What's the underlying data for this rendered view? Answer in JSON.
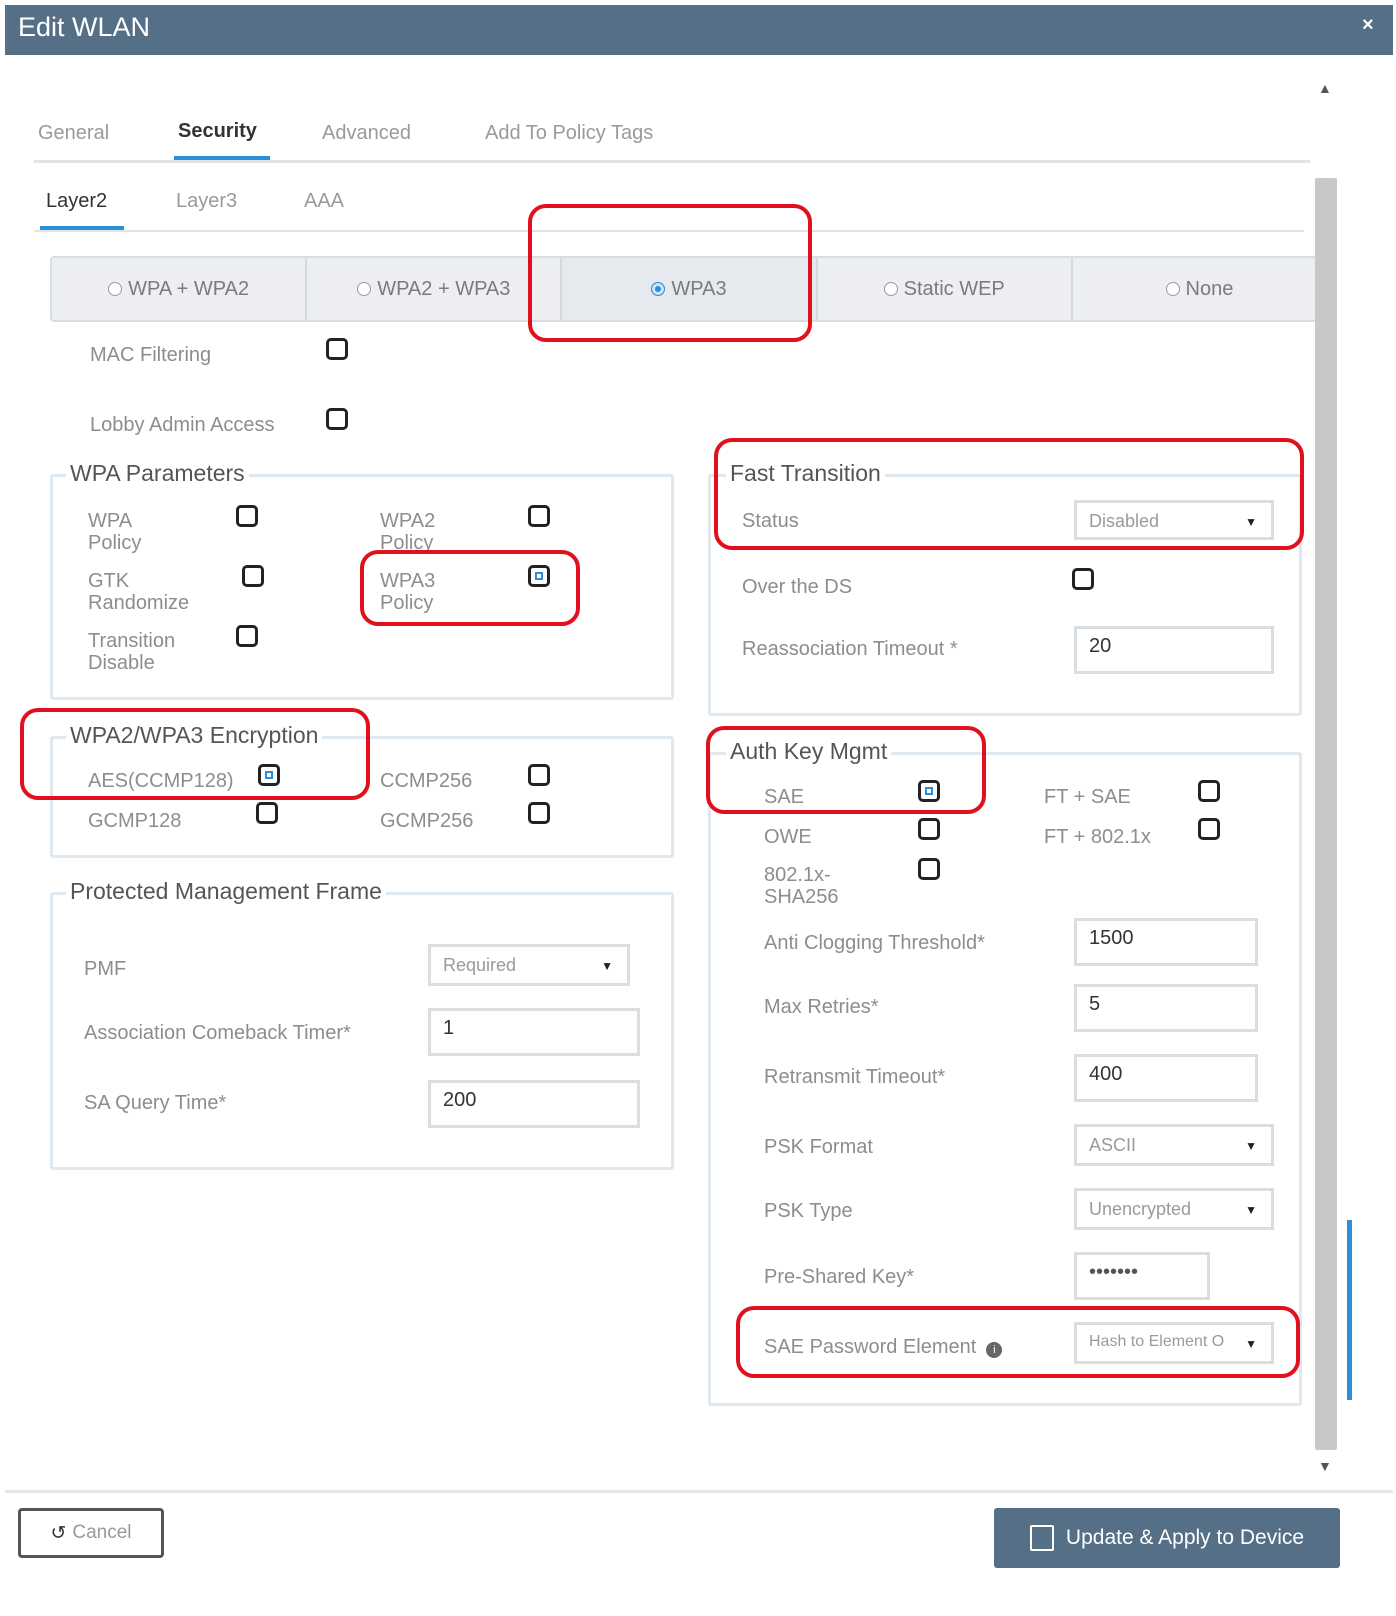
{
  "window": {
    "title": "Edit WLAN",
    "close_icon": "×"
  },
  "tabs": [
    {
      "label": "General"
    },
    {
      "label": "Security",
      "active": true
    },
    {
      "label": "Advanced"
    },
    {
      "label": "Add To Policy Tags"
    }
  ],
  "subtabs": [
    {
      "label": "Layer2",
      "active": true
    },
    {
      "label": "Layer3"
    },
    {
      "label": "AAA"
    }
  ],
  "security_modes": [
    {
      "label": "WPA + WPA2",
      "selected": false
    },
    {
      "label": "WPA2 + WPA3",
      "selected": false
    },
    {
      "label": "WPA3",
      "selected": true
    },
    {
      "label": "Static WEP",
      "selected": false
    },
    {
      "label": "None",
      "selected": false
    }
  ],
  "mac_filtering": {
    "label": "MAC Filtering",
    "checked": false
  },
  "lobby_admin": {
    "label": "Lobby Admin Access",
    "checked": false
  },
  "wpa_params": {
    "legend": "WPA Parameters",
    "wpa_policy": {
      "label": "WPA\nPolicy",
      "checked": false
    },
    "wpa2_policy": {
      "label": "WPA2\nPolicy",
      "checked": false
    },
    "gtk_randomize": {
      "label": "GTK\nRandomize",
      "checked": false
    },
    "wpa3_policy": {
      "label": "WPA3\nPolicy",
      "checked": true
    },
    "transition_disable": {
      "label": "Transition\nDisable",
      "checked": false
    }
  },
  "encryption": {
    "legend": "WPA2/WPA3 Encryption",
    "aes_ccmp128": {
      "label": "AES(CCMP128)",
      "checked": true
    },
    "ccmp256": {
      "label": "CCMP256",
      "checked": false
    },
    "gcmp128": {
      "label": "GCMP128",
      "checked": false
    },
    "gcmp256": {
      "label": "GCMP256",
      "checked": false
    }
  },
  "pmf": {
    "legend": "Protected Management Frame",
    "pmf_label": "PMF",
    "pmf_value": "Required",
    "comeback_label": "Association Comeback Timer*",
    "comeback_value": "1",
    "sa_query_label": "SA Query Time*",
    "sa_query_value": "200"
  },
  "fast_transition": {
    "legend": "Fast Transition",
    "status_label": "Status",
    "status_value": "Disabled",
    "over_ds_label": "Over the DS",
    "over_ds_checked": false,
    "reassoc_label": "Reassociation Timeout *",
    "reassoc_value": "20"
  },
  "akm": {
    "legend": "Auth Key Mgmt",
    "sae": {
      "label": "SAE",
      "checked": true
    },
    "ft_sae": {
      "label": "FT + SAE",
      "checked": false
    },
    "owe": {
      "label": "OWE",
      "checked": false
    },
    "ft_8021x": {
      "label": "FT + 802.1x",
      "checked": false
    },
    "sha256": {
      "label": "802.1x-\nSHA256",
      "checked": false
    },
    "anti_clog_label": "Anti Clogging Threshold*",
    "anti_clog_value": "1500",
    "max_retries_label": "Max Retries*",
    "max_retries_value": "5",
    "retransmit_label": "Retransmit Timeout*",
    "retransmit_value": "400",
    "psk_format_label": "PSK Format",
    "psk_format_value": "ASCII",
    "psk_type_label": "PSK Type",
    "psk_type_value": "Unencrypted",
    "psk_label": "Pre-Shared Key*",
    "psk_value": "•••••••",
    "sae_pwe_label": "SAE Password Element",
    "sae_pwe_value": "Hash to Element O"
  },
  "footer": {
    "cancel_label": "Cancel",
    "update_label": "Update & Apply to Device"
  },
  "colors": {
    "titlebar": "#556f86",
    "accent": "#2a8fd6",
    "highlight": "#e0101c"
  }
}
